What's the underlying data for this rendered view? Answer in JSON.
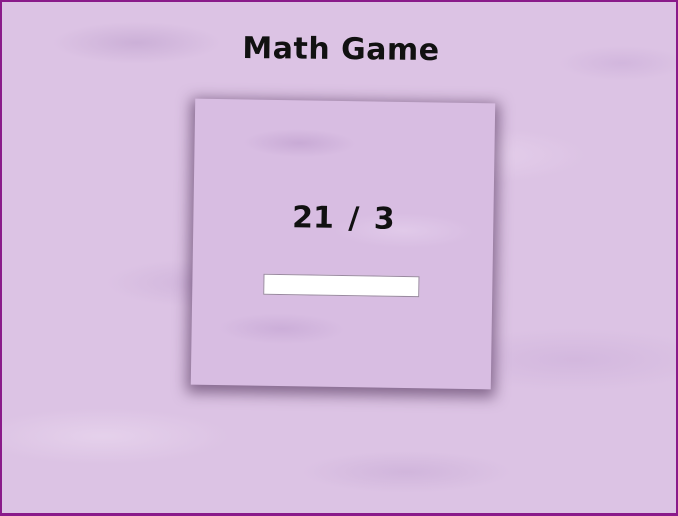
{
  "game": {
    "title": "Math Game",
    "problem": "21 / 3",
    "answer": {
      "value": "",
      "placeholder": ""
    }
  },
  "colors": {
    "border": "#8a1a8a",
    "background": "#dcc3e4",
    "card": "#d8bde2",
    "text": "#111111"
  }
}
